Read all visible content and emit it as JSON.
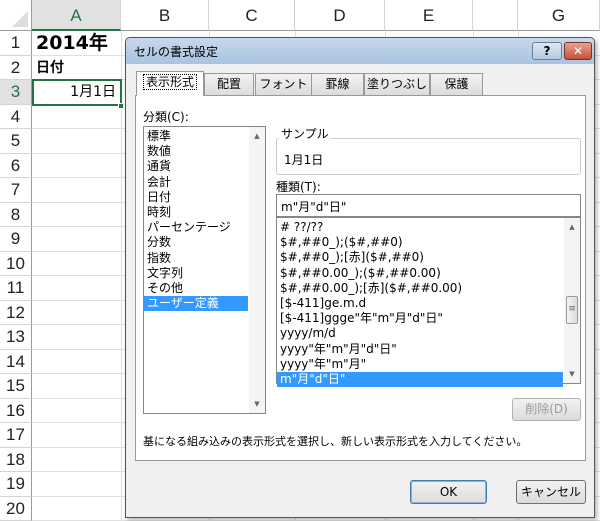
{
  "spreadsheet": {
    "columns": [
      "A",
      "B",
      "C",
      "D",
      "E",
      "",
      "G"
    ],
    "rows": [
      "1",
      "2",
      "3",
      "4",
      "5",
      "6",
      "7",
      "8",
      "9",
      "10",
      "11",
      "12",
      "13",
      "14",
      "15",
      "16",
      "17",
      "18",
      "19",
      "20"
    ],
    "cells": {
      "A1": "2014年",
      "A2": "日付",
      "A3": "1月1日"
    }
  },
  "dialog": {
    "title": "セルの書式設定",
    "help_label": "?",
    "close_label": "✕",
    "tabs": [
      "表示形式",
      "配置",
      "フォント",
      "罫線",
      "塗りつぶし",
      "保護"
    ],
    "category_label": "分類(C):",
    "categories": [
      "標準",
      "数値",
      "通貨",
      "会計",
      "日付",
      "時刻",
      "パーセンテージ",
      "分数",
      "指数",
      "文字列",
      "その他",
      "ユーザー定義"
    ],
    "selected_category": "ユーザー定義",
    "sample_label": "サンプル",
    "sample_value": "1月1日",
    "type_label": "種類(T):",
    "type_value": "m\"月\"d\"日\"",
    "formats": [
      "# ??/??",
      "$#,##0_);($#,##0)",
      "$#,##0_);[赤]($#,##0)",
      "$#,##0.00_);($#,##0.00)",
      "$#,##0.00_);[赤]($#,##0.00)",
      "[$-411]ge.m.d",
      "[$-411]ggge\"年\"m\"月\"d\"日\"",
      "yyyy/m/d",
      "yyyy\"年\"m\"月\"d\"日\"",
      "yyyy\"年\"m\"月\"",
      "m\"月\"d\"日\""
    ],
    "selected_format": "m\"月\"d\"日\"",
    "delete_label": "削除(D)",
    "description": "基になる組み込みの表示形式を選択し、新しい表示形式を入力してください。",
    "ok_label": "OK",
    "cancel_label": "キャンセル"
  }
}
